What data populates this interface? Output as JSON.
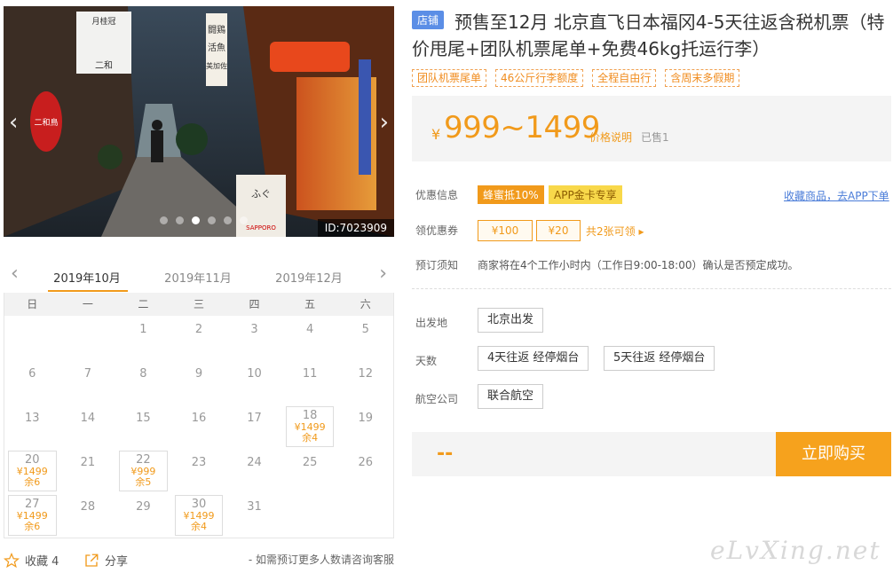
{
  "photo": {
    "id_text": "ID:7023909",
    "dots": 6,
    "active_dot": 2,
    "signs": [
      "月桂冠",
      "二和",
      "闘鶏",
      "活魚",
      "美加佐",
      "二和鳥",
      "ふぐ",
      "SAPPORO"
    ]
  },
  "calendar": {
    "months": [
      "2019年10月",
      "2019年11月",
      "2019年12月"
    ],
    "active_month": 0,
    "weekdays": [
      "日",
      "一",
      "二",
      "三",
      "四",
      "五",
      "六"
    ],
    "leading_blanks": 2,
    "days": [
      {
        "d": "1"
      },
      {
        "d": "2"
      },
      {
        "d": "3"
      },
      {
        "d": "4"
      },
      {
        "d": "5"
      },
      {
        "d": "6"
      },
      {
        "d": "7"
      },
      {
        "d": "8"
      },
      {
        "d": "9"
      },
      {
        "d": "10"
      },
      {
        "d": "11"
      },
      {
        "d": "12"
      },
      {
        "d": "13"
      },
      {
        "d": "14"
      },
      {
        "d": "15"
      },
      {
        "d": "16"
      },
      {
        "d": "17"
      },
      {
        "d": "18",
        "price": "¥1499",
        "left": "余4"
      },
      {
        "d": "19"
      },
      {
        "d": "20",
        "price": "¥1499",
        "left": "余6"
      },
      {
        "d": "21"
      },
      {
        "d": "22",
        "price": "¥999",
        "left": "余5"
      },
      {
        "d": "23"
      },
      {
        "d": "24"
      },
      {
        "d": "25"
      },
      {
        "d": "26"
      },
      {
        "d": "27",
        "price": "¥1499",
        "left": "余6"
      },
      {
        "d": "28"
      },
      {
        "d": "29"
      },
      {
        "d": "30",
        "price": "¥1499",
        "left": "余4"
      },
      {
        "d": "31"
      }
    ]
  },
  "footer": {
    "collect": "收藏 4",
    "share": "分享",
    "consult": "- 如需预订更多人数请咨询客服"
  },
  "product": {
    "shop_tag": "店铺",
    "title": "预售至12月 北京直飞日本福冈4-5天往返含税机票（特价甩尾+团队机票尾单+免费46kg托运行李）",
    "tags": [
      "团队机票尾单",
      "46公斤行李额度",
      "全程自由行",
      "含周末多假期"
    ],
    "price_yen": "¥",
    "price_range": "999~1499",
    "price_note": "价格说明",
    "sold": "已售1"
  },
  "info": {
    "promo_label": "优惠信息",
    "promo1": "蜂蜜抵10%",
    "promo2": "APP金卡专享",
    "fav_link": "收藏商品，去APP下单",
    "coupon_label": "领优惠券",
    "coupon1": "¥100",
    "coupon2": "¥20",
    "coupon_count": "共2张可领 ▸",
    "notice_label": "预订须知",
    "notice_text": "商家将在4个工作小时内（工作日9:00-18:00）确认是否预定成功。"
  },
  "options": {
    "depart_label": "出发地",
    "depart": [
      "北京出发"
    ],
    "days_label": "天数",
    "days": [
      "4天往返 经停烟台",
      "5天往返 经停烟台"
    ],
    "airline_label": "航空公司",
    "airline": [
      "联合航空"
    ]
  },
  "buy": {
    "total": "--",
    "button": "立即购买"
  },
  "watermark": "eLvXing.net",
  "colors": {
    "accent": "#f19a1b",
    "button": "#f6a21d",
    "link": "#4a7cd8",
    "shop_tag": "#5b8ee6"
  }
}
